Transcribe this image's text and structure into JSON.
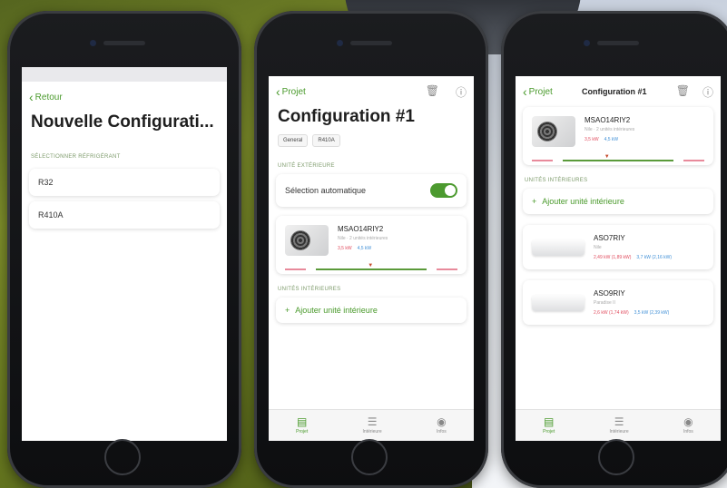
{
  "phone1": {
    "back_label": "Retour",
    "title": "Nouvelle Configurati...",
    "section": "SÉLECTIONNER RÉFRIGÉRANT",
    "options": [
      "R32",
      "R410A"
    ]
  },
  "phone2": {
    "back_label": "Projet",
    "title": "Configuration #1",
    "chips": [
      "General",
      "R410A"
    ],
    "outdoor_section": "UNITÉ EXTÉRIEURE",
    "auto_select_label": "Sélection automatique",
    "unit": {
      "model": "MSAO14RIY2",
      "sub": "Nile · 2 unités intérieures",
      "power_red": "3,5 kW",
      "power_blue": "4,5 kW"
    },
    "indoor_section": "UNITÉS INTÉRIEURES",
    "add_label": "Ajouter unité intérieure",
    "tabs": [
      {
        "label": "Projet",
        "icon": "clipboard-icon"
      },
      {
        "label": "Intérieure",
        "icon": "list-icon"
      },
      {
        "label": "Infos",
        "icon": "info-circle-icon"
      }
    ]
  },
  "phone3": {
    "back_label": "Projet",
    "title": "Configuration #1",
    "unit": {
      "model": "MSAO14RIY2",
      "sub": "Nile · 2 unités intérieures",
      "power_red": "3,5 kW",
      "power_blue": "4,5 kW"
    },
    "indoor_section": "UNITÉS INTÉRIEURES",
    "add_label": "Ajouter unité intérieure",
    "indoor_units": [
      {
        "model": "ASO7RIY",
        "sub": "Nile",
        "power_red": "2,49 kW (1,89 kW)",
        "power_blue": "3,7 kW (2,16 kW)"
      },
      {
        "model": "ASO9RIY",
        "sub": "Paradise II",
        "power_red": "2,6 kW (1,74 kW)",
        "power_blue": "3,5 kW (2,39 kW)"
      }
    ],
    "tabs": [
      {
        "label": "Projet",
        "icon": "clipboard-icon"
      },
      {
        "label": "Intérieure",
        "icon": "list-icon"
      },
      {
        "label": "Infos",
        "icon": "info-circle-icon"
      }
    ]
  },
  "colors": {
    "accent": "#4a9a2c",
    "power_red": "#e04a5c",
    "power_blue": "#3f8fd6"
  }
}
